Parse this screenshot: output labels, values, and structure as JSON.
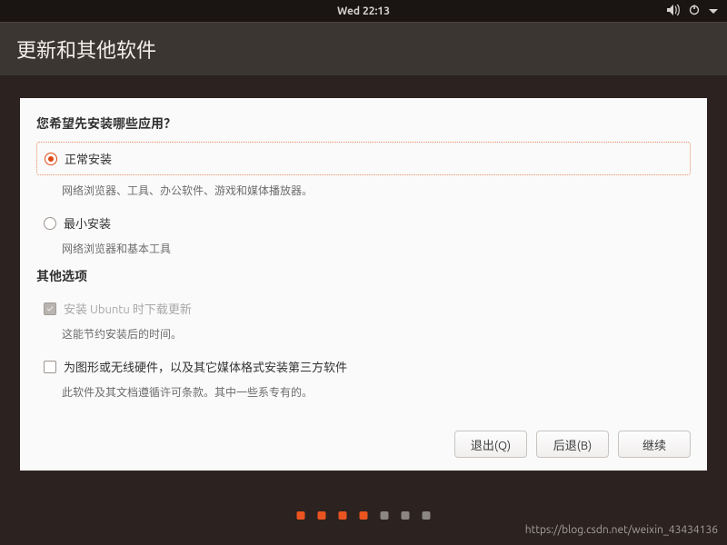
{
  "topbar": {
    "clock": "Wed 22:13"
  },
  "titlebar": {
    "title": "更新和其他软件"
  },
  "main": {
    "question": "您希望先安装哪些应用？",
    "options": [
      {
        "label": "正常安装",
        "desc": "网络浏览器、工具、办公软件、游戏和媒体播放器。",
        "selected": true
      },
      {
        "label": "最小安装",
        "desc": "网络浏览器和基本工具",
        "selected": false
      }
    ],
    "other_heading": "其他选项",
    "checks": [
      {
        "label": "安装 Ubuntu 时下载更新",
        "desc": "这能节约安装后的时间。",
        "checked": true,
        "disabled": true
      },
      {
        "label": "为图形或无线硬件，以及其它媒体格式安装第三方软件",
        "desc": "此软件及其文档遵循许可条款。其中一些系专有的。",
        "checked": false,
        "disabled": false
      }
    ],
    "buttons": {
      "quit": "退出(Q)",
      "back": "后退(B)",
      "continue": "继续"
    }
  },
  "watermark": "https://blog.csdn.net/weixin_43434136"
}
